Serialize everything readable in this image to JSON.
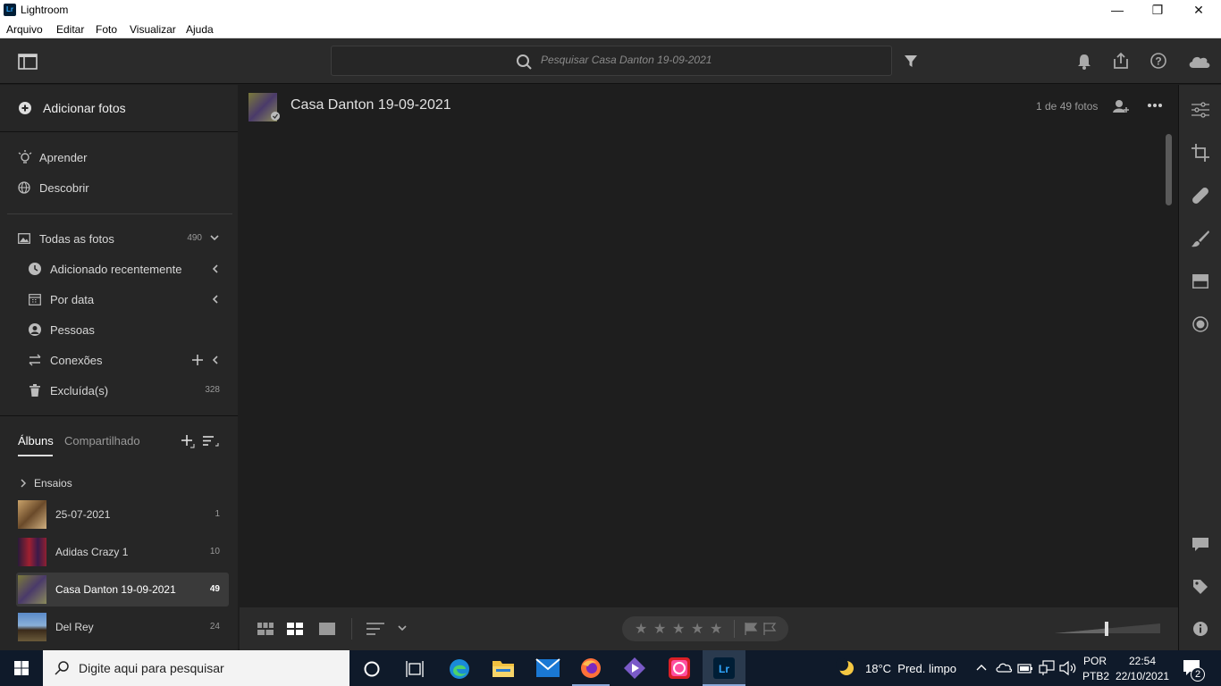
{
  "window": {
    "app_icon": "Lr",
    "title": "Lightroom"
  },
  "menu": [
    "Arquivo",
    "Editar",
    "Foto",
    "Visualizar",
    "Ajuda"
  ],
  "search": {
    "placeholder": "Pesquisar Casa Danton 19-09-2021"
  },
  "sidebar": {
    "add_photos": "Adicionar fotos",
    "learn": "Aprender",
    "discover": "Descobrir",
    "all_photos": {
      "label": "Todas as fotos",
      "count": "490"
    },
    "recently_added": "Adicionado recentemente",
    "by_date": "Por data",
    "people": "Pessoas",
    "connections": "Conexões",
    "deleted": {
      "label": "Excluída(s)",
      "count": "328"
    },
    "tabs": {
      "albums": "Álbuns",
      "shared": "Compartilhado"
    },
    "folder": "Ensaios",
    "albums": [
      {
        "name": "25-07-2021",
        "count": "1",
        "color": "#7a5a3a"
      },
      {
        "name": "Adidas Crazy 1",
        "count": "10",
        "color": "#8a1f2a"
      },
      {
        "name": "Casa Danton 19-09-2021",
        "count": "49",
        "color": "#6a6a3a",
        "selected": true
      },
      {
        "name": "Del Rey",
        "count": "24",
        "color": "#3a6a9a"
      }
    ]
  },
  "main": {
    "title": "Casa Danton 19-09-2021",
    "count": "1 de 49 fotos"
  },
  "taskbar": {
    "search_placeholder": "Digite aqui para pesquisar",
    "weather": "18°C  Pred. limpo",
    "lang": "POR",
    "lang2": "PTB2",
    "time": "22:54",
    "date": "22/10/2021",
    "notifications": "2"
  }
}
